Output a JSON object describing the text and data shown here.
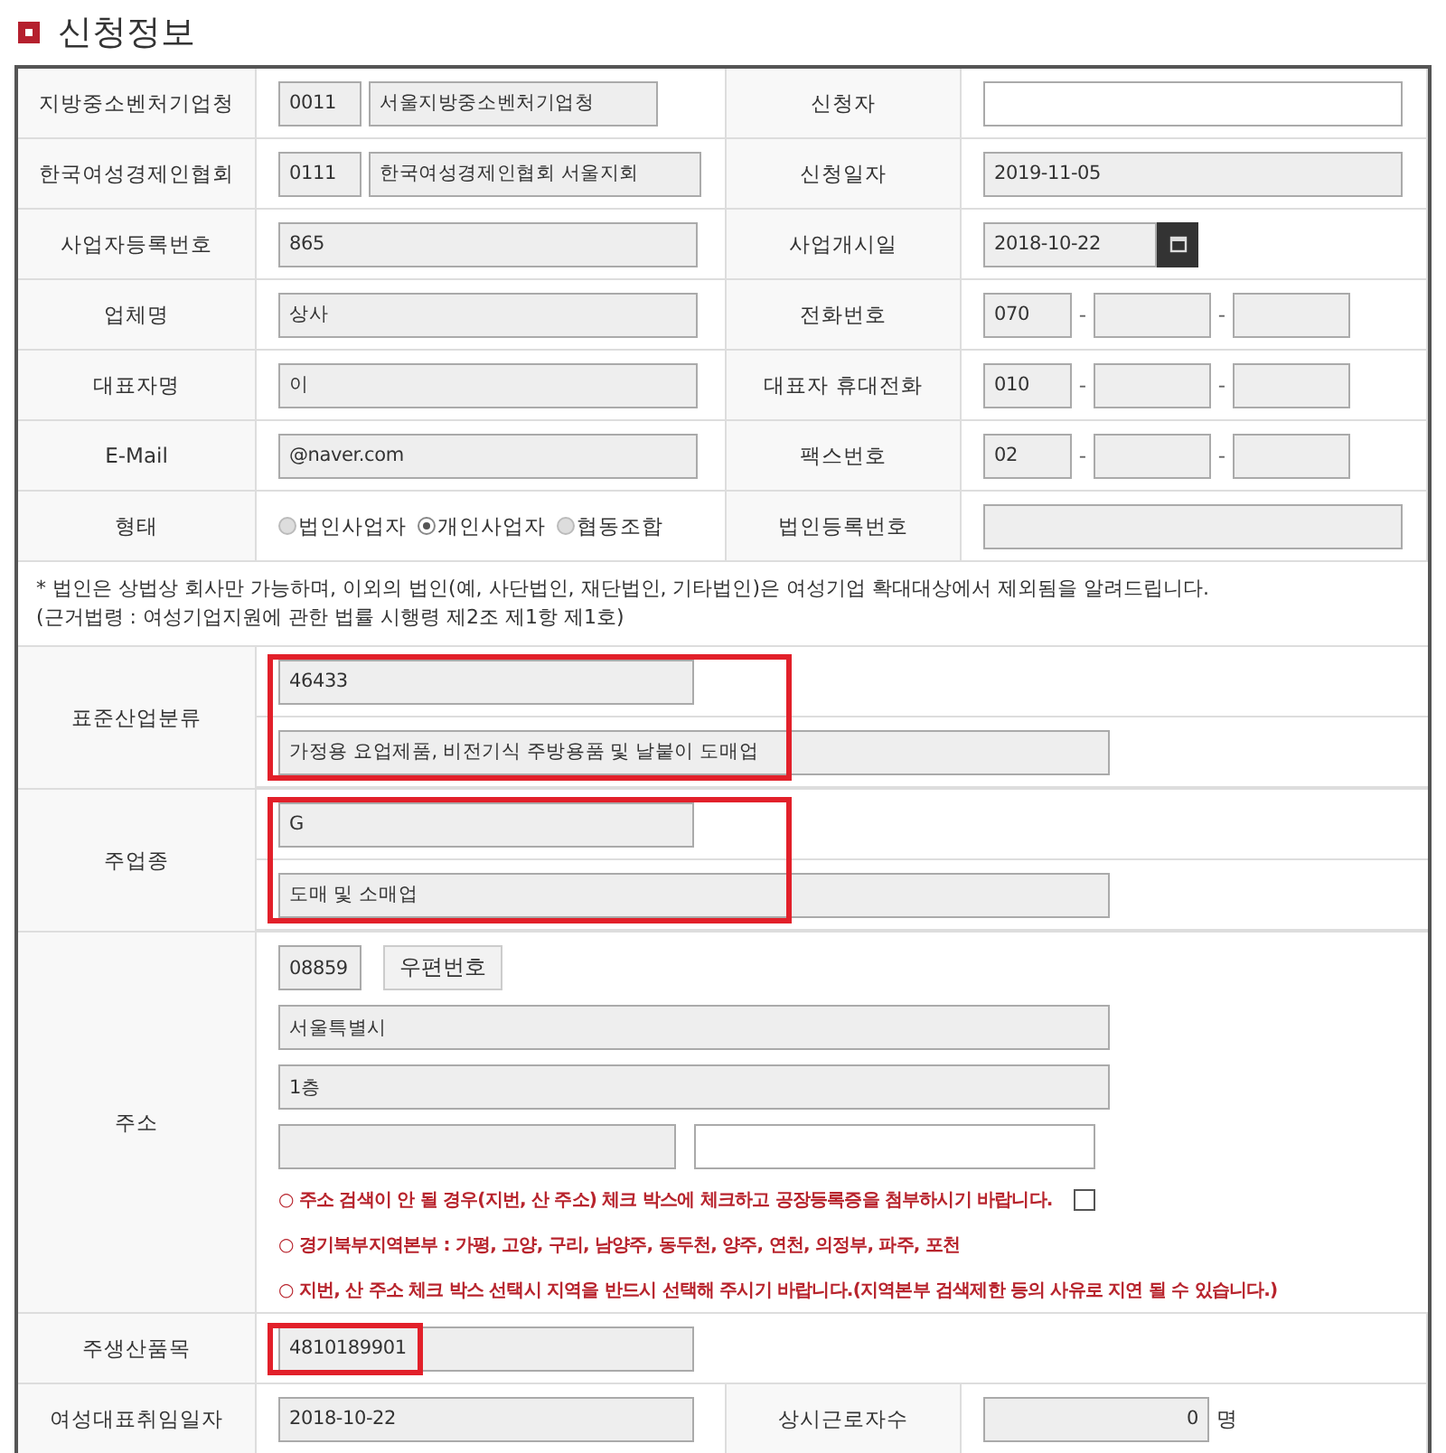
{
  "title": "신청정보",
  "pair_rows": [
    {
      "left": {
        "label": "지방중소벤처기업청",
        "kind": "code_name",
        "code": "0011",
        "name": "서울지방중소벤처기업청"
      },
      "right": {
        "label": "신청자",
        "kind": "input"
      }
    },
    {
      "left": {
        "label": "한국여성경제인협회",
        "kind": "code_name",
        "code": "0111",
        "name": "한국여성경제인협회 서울지회"
      },
      "right": {
        "label": "신청일자",
        "kind": "text",
        "value": "2019-11-05"
      }
    },
    {
      "left": {
        "label": "사업자등록번호",
        "kind": "text",
        "value": "865"
      },
      "right": {
        "label": "사업개시일",
        "kind": "date",
        "value": "2018-10-22"
      }
    },
    {
      "left": {
        "label": "업체명",
        "kind": "text",
        "value": "상사"
      },
      "right": {
        "label": "전화번호",
        "kind": "phone",
        "area": "070",
        "separators": [
          "-",
          "-"
        ]
      }
    },
    {
      "left": {
        "label": "대표자명",
        "kind": "text",
        "value": "이"
      },
      "right": {
        "label": "대표자 휴대전화",
        "kind": "phone",
        "area": "010",
        "separators": [
          "-",
          "-"
        ]
      }
    },
    {
      "left": {
        "label": "E-Mail",
        "kind": "text",
        "value": "@naver.com"
      },
      "right": {
        "label": "팩스번호",
        "kind": "phone",
        "area": "02",
        "separators": [
          "-",
          "-"
        ]
      }
    },
    {
      "left": {
        "label": "형태",
        "kind": "radio",
        "options": [
          {
            "label": "법인사업자",
            "selected": false
          },
          {
            "label": "개인사업자",
            "selected": true
          },
          {
            "label": "협동조합",
            "selected": false
          }
        ]
      },
      "right": {
        "label": "법인등록번호",
        "kind": "text"
      }
    }
  ],
  "notice": [
    "* 법인은 상법상 회사만 가능하며, 이외의 법인(예, 사단법인, 재단법인, 기타법인)은 여성기업 확대대상에서 제외됨을 알려드립니다.",
    "(근거법령 : 여성기업지원에 관한 법률 시행령 제2조 제1항 제1호)"
  ],
  "classifications": [
    {
      "label": "표준산업분류",
      "highlighted": true,
      "code": "46433",
      "name": "가정용 요업제품, 비전기식 주방용품 및 날붙이 도매업"
    },
    {
      "label": "주업종",
      "highlighted": true,
      "code": "G",
      "name": "도매 및 소매업"
    }
  ],
  "address": {
    "label": "주소",
    "zip": "08859",
    "zip_button": "우편번호",
    "lines": [
      "서울특별시",
      "1층"
    ],
    "notes": [
      {
        "text": "○ 주소 검색이 안 될 경우(지번, 산 주소) 체크 박스에 체크하고 공장등록증을 첨부하시기 바랍니다.",
        "checked": false
      },
      {
        "text": "○ 경기북부지역본부 : 가평, 고양, 구리, 남양주, 동두천, 양주, 연천, 의정부, 파주, 포천"
      },
      {
        "text": "○ 지번, 산 주소 체크 박스 선택시 지역을 반드시 선택해 주시기 바랍니다.(지역본부 검색제한 등의 사유로 지연 될 수 있습니다.)"
      }
    ]
  },
  "product": {
    "label": "주생산품목",
    "value": "4810189901",
    "highlighted": true
  },
  "last_row": {
    "left": {
      "label": "여성대표취임일자",
      "value": "2018-10-22"
    },
    "right": {
      "label": "상시근로자수",
      "value": "0",
      "unit": "명"
    }
  }
}
